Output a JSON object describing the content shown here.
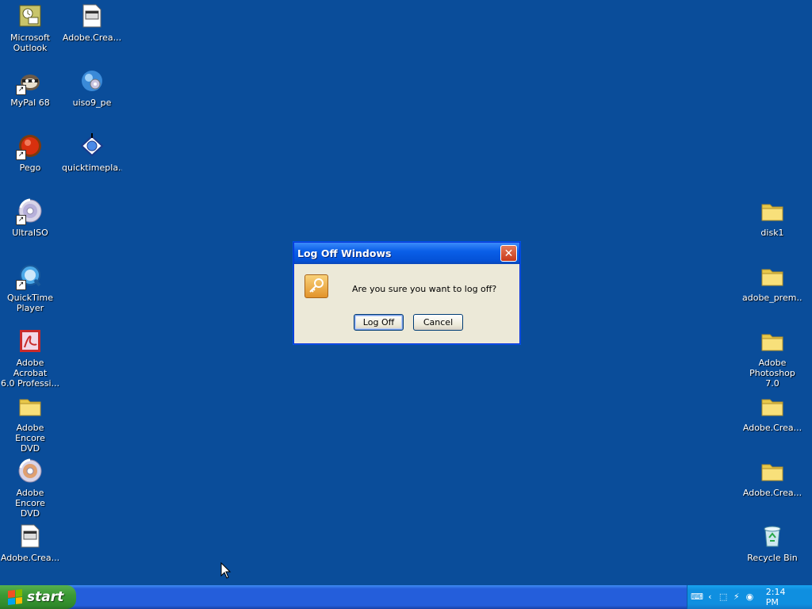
{
  "desktop": {
    "background_color": "#0a4d9a",
    "icons_left_col1": [
      {
        "label": "Microsoft\nOutlook",
        "icon": "outlook-icon"
      },
      {
        "label": "MyPal 68",
        "icon": "mypal-icon"
      },
      {
        "label": "Pego",
        "icon": "pego-icon"
      },
      {
        "label": "UltraISO",
        "icon": "disc-icon"
      },
      {
        "label": "QuickTime\nPlayer",
        "icon": "quicktime-icon"
      },
      {
        "label": "Adobe Acrobat\n6.0 Professi...",
        "icon": "acrobat-icon"
      },
      {
        "label": "Adobe Encore\nDVD",
        "icon": "folder-icon"
      },
      {
        "label": "Adobe Encore\nDVD",
        "icon": "disc-icon"
      },
      {
        "label": "Adobe.Crea...",
        "icon": "file-icon"
      }
    ],
    "icons_left_col2": [
      {
        "label": "Adobe.Crea...",
        "icon": "file-icon"
      },
      {
        "label": "uiso9_pe",
        "icon": "installer-icon"
      },
      {
        "label": "quicktimepla...",
        "icon": "quicktime-installer-icon"
      }
    ],
    "icons_right": [
      {
        "label": "disk1",
        "icon": "folder-icon"
      },
      {
        "label": "adobe_prem...",
        "icon": "folder-icon"
      },
      {
        "label": "Adobe\nPhotoshop 7.0",
        "icon": "folder-icon"
      },
      {
        "label": "Adobe.Crea...",
        "icon": "folder-icon"
      },
      {
        "label": "Adobe.Crea...",
        "icon": "folder-icon"
      },
      {
        "label": "Recycle Bin",
        "icon": "recycle-bin-icon"
      }
    ]
  },
  "dialog": {
    "title": "Log Off Windows",
    "message": "Are you sure you want to log off?",
    "logoff_label": "Log Off",
    "cancel_label": "Cancel",
    "close_symbol": "✕"
  },
  "taskbar": {
    "start_label": "start",
    "clock": "2:14 PM",
    "tray_icons": [
      "keyboard-icon",
      "chevron-left-icon",
      "network-icon",
      "connection-icon",
      "volume-icon"
    ]
  }
}
